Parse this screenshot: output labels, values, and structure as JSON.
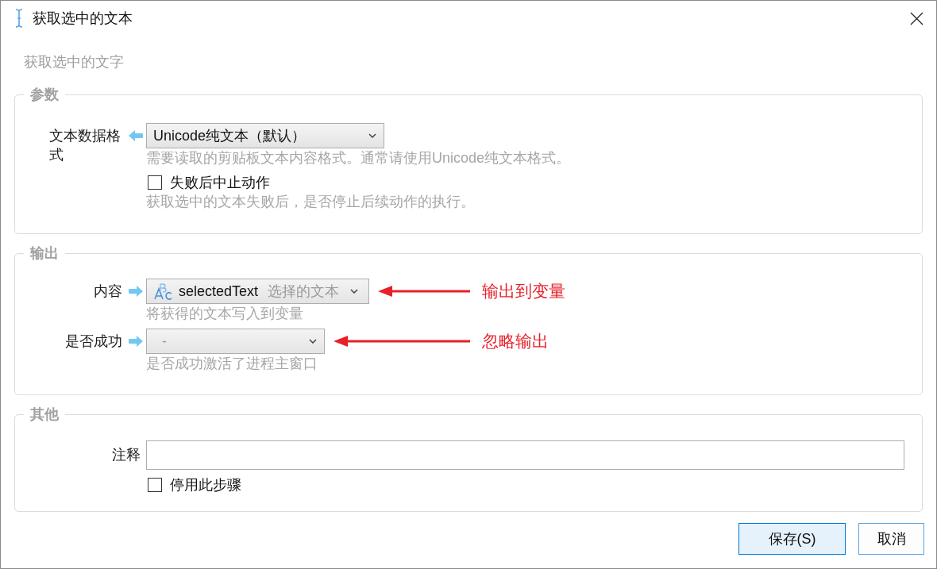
{
  "window": {
    "title": "获取选中的文本"
  },
  "description": "获取选中的文字",
  "groups": [
    {
      "title": "参数",
      "kind": "input",
      "rows": [
        {
          "kind": "dropdown",
          "label": "文本数据格式",
          "value": "Unicode纯文本（默认）",
          "hint": "需要读取的剪贴板文本内容格式。通常请使用Unicode纯文本格式。"
        },
        {
          "kind": "checkbox",
          "label": "失败后中止动作",
          "checked": false,
          "hint": "获取选中的文本失败后，是否停止后续动作的执行。"
        }
      ]
    },
    {
      "title": "输出",
      "kind": "output",
      "rows": [
        {
          "kind": "variable",
          "label": "内容",
          "value": "selectedText",
          "note": "选择的文本",
          "hint": "将获得的文本写入到变量",
          "annotation": "输出到变量"
        },
        {
          "kind": "dropdown",
          "label": "是否成功",
          "placeholder": "-",
          "hint": "是否成功激活了进程主窗口",
          "annotation": "忽略输出"
        }
      ]
    },
    {
      "title": "其他",
      "kind": "other",
      "rows": [
        {
          "kind": "text",
          "label": "注释"
        },
        {
          "kind": "checkbox",
          "label": "停用此步骤",
          "checked": false
        }
      ]
    }
  ],
  "buttons": [
    {
      "label": "保存(S)",
      "default": true
    },
    {
      "label": "取消",
      "default": false
    }
  ]
}
